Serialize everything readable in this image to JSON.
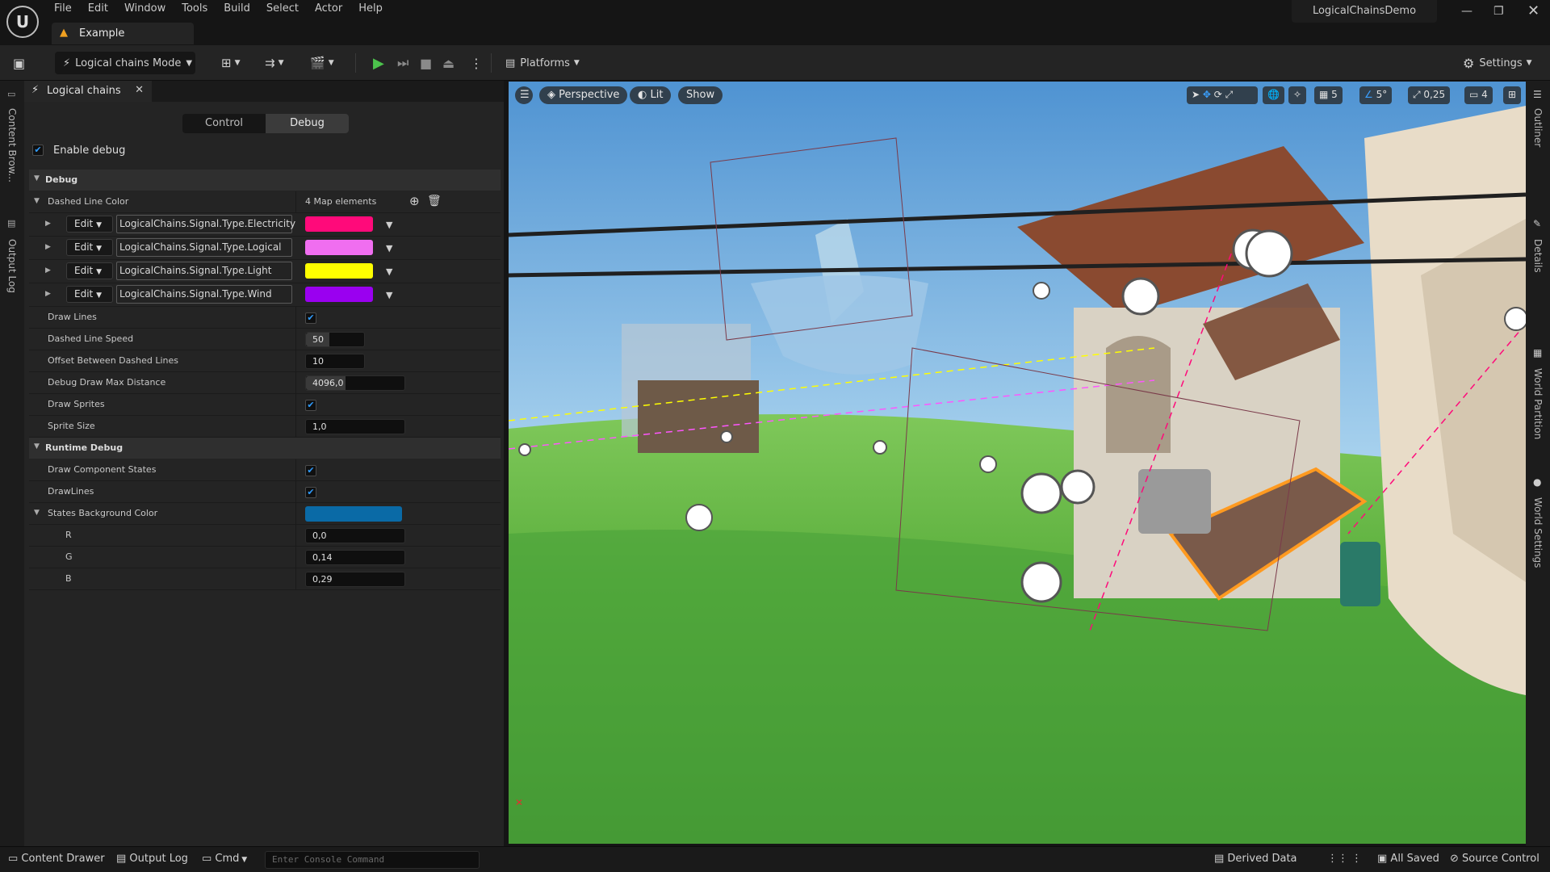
{
  "menu": [
    "File",
    "Edit",
    "Window",
    "Tools",
    "Build",
    "Select",
    "Actor",
    "Help"
  ],
  "document_tab": "Example",
  "project_title": "LogicalChainsDemo",
  "toolbar": {
    "mode": "Logical chains Mode",
    "platforms": "Platforms",
    "settings": "Settings"
  },
  "left_strip": {
    "content_browser": "Content Brow...",
    "output_log": "Output Log"
  },
  "panel": {
    "tab": "Logical chains",
    "modes": [
      "Control",
      "Debug"
    ],
    "active_mode": "Debug",
    "enable_debug": "Enable debug",
    "debug_section": "Debug",
    "dashed_line_color": "Dashed Line Color",
    "map_elements": "4 Map elements",
    "edit_label": "Edit",
    "map_entries": [
      {
        "key": "LogicalChains.Signal.Type.Electricity",
        "color": "#ff0a7a"
      },
      {
        "key": "LogicalChains.Signal.Type.Logical",
        "color": "#f06ef0"
      },
      {
        "key": "LogicalChains.Signal.Type.Light",
        "color": "#ffff00"
      },
      {
        "key": "LogicalChains.Signal.Type.Wind",
        "color": "#9a00f0"
      }
    ],
    "draw_lines": "Draw Lines",
    "dashed_line_speed": {
      "label": "Dashed Line Speed",
      "value": "50"
    },
    "offset_between": {
      "label": "Offset Between Dashed Lines",
      "value": "10"
    },
    "max_distance": {
      "label": "Debug Draw Max Distance",
      "value": "4096,0"
    },
    "draw_sprites": "Draw Sprites",
    "sprite_size": {
      "label": "Sprite Size",
      "value": "1,0"
    },
    "runtime_section": "Runtime Debug",
    "draw_component_states": "Draw Component States",
    "drawlines": "DrawLines",
    "states_bg": {
      "label": "States Background Color",
      "color": "#0a6aa6"
    },
    "r": {
      "label": "R",
      "value": "0,0"
    },
    "g": {
      "label": "G",
      "value": "0,14"
    },
    "b": {
      "label": "B",
      "value": "0,29"
    }
  },
  "viewport": {
    "perspective": "Perspective",
    "lit": "Lit",
    "show": "Show",
    "grid": "5",
    "angle": "5°",
    "scale": "0,25",
    "cam": "4"
  },
  "right_strip": [
    "Outliner",
    "Details",
    "World Partition",
    "World Settings"
  ],
  "status": {
    "content_drawer": "Content Drawer",
    "output_log": "Output Log",
    "cmd": "Cmd",
    "console_placeholder": "Enter Console Command",
    "derived_data": "Derived Data",
    "all_saved": "All Saved",
    "source_control": "Source Control"
  }
}
